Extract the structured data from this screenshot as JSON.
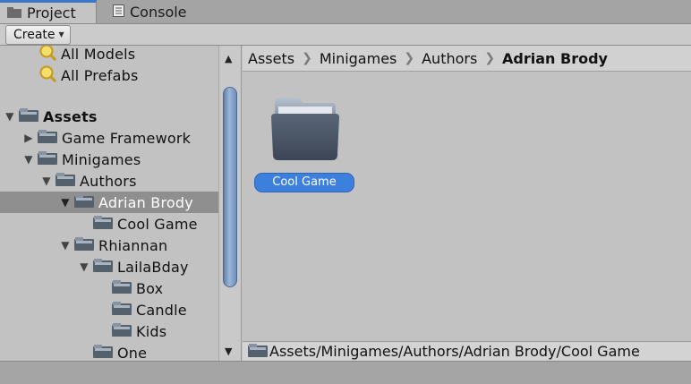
{
  "tabs": [
    {
      "label": "Project",
      "icon": "folder-icon",
      "active": true
    },
    {
      "label": "Console",
      "icon": "console-icon",
      "active": false
    }
  ],
  "toolbar": {
    "create_label": "Create"
  },
  "tree": {
    "favorites": [
      "All Models",
      "All Prefabs"
    ],
    "items": [
      {
        "label": "Assets",
        "expanded": true,
        "bold": true
      },
      {
        "label": "Game Framework",
        "expanded": false
      },
      {
        "label": "Minigames",
        "expanded": true
      },
      {
        "label": "Authors",
        "expanded": true
      },
      {
        "label": "Adrian Brody",
        "expanded": true,
        "selected": true
      },
      {
        "label": "Cool Game"
      },
      {
        "label": "Rhiannan",
        "expanded": true
      },
      {
        "label": "LailaBday",
        "expanded": true
      },
      {
        "label": "Box"
      },
      {
        "label": "Candle"
      },
      {
        "label": "Kids"
      },
      {
        "label": "One"
      }
    ]
  },
  "breadcrumb": [
    "Assets",
    "Minigames",
    "Authors",
    "Adrian Brody"
  ],
  "asset": {
    "label": "Cool Game"
  },
  "pathbar": {
    "path": "Assets/Minigames/Authors/Adrian Brody/Cool Game"
  },
  "colors": {
    "accent": "#3a77c9",
    "selection_label": "#3d7fdc",
    "selected_row": "#8f8f8f"
  }
}
